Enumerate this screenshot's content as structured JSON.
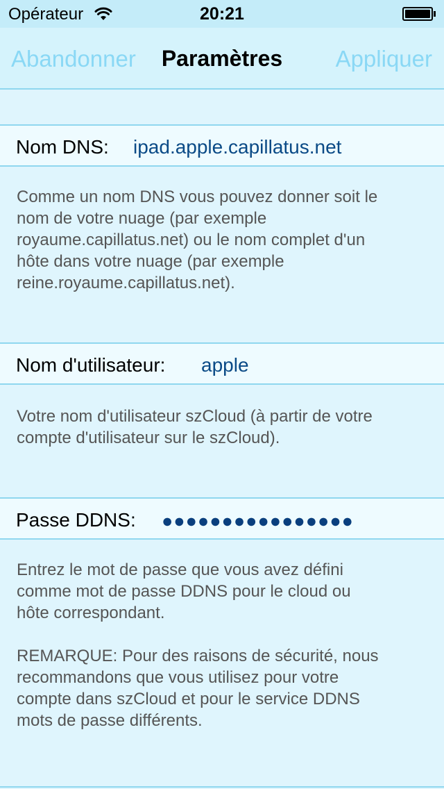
{
  "status_bar": {
    "carrier": "Opérateur",
    "time": "20:21",
    "wifi_icon": "wifi-icon",
    "battery_icon": "battery-icon"
  },
  "nav": {
    "cancel_label": "Abandonner",
    "title": "Paramètres",
    "apply_label": "Appliquer"
  },
  "dns": {
    "label": "Nom DNS:",
    "value": "ipad.apple.capillatus.net",
    "description": "Comme un nom DNS vous pouvez donner soit le\nnom de votre nuage (par exemple\nroyaume.capillatus.net) ou le nom complet d'un\nhôte dans votre nuage (par exemple\nreine.royaume.capillatus.net)."
  },
  "user": {
    "label": "Nom d'utilisateur:",
    "value": "apple",
    "description": "Votre nom d'utilisateur szCloud (à partir de votre\ncompte d'utilisateur sur le szCloud)."
  },
  "password": {
    "label": "Passe DDNS:",
    "masked_value": "●●●●●●●●●●●●●●●●",
    "description": "Entrez le mot de passe que vous avez défini\ncomme mot de passe DDNS pour le cloud ou\nhôte correspondant.",
    "note": "REMARQUE: Pour des raisons de sécurité, nous\nrecommandons que vous utilisez pour votre\ncompte dans szCloud et pour le service DDNS\nmots de passe différents."
  },
  "colors": {
    "background": "#dff5fd",
    "nav_button": "#8ad8f5",
    "value_text": "#0a4a86",
    "separator": "#8fd7ef"
  }
}
